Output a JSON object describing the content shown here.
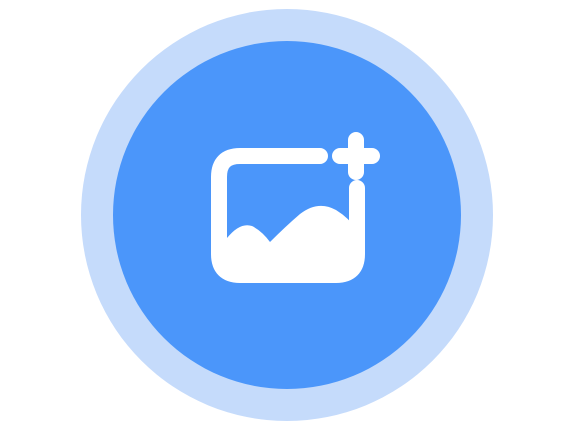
{
  "colors": {
    "ring": "#c5dbfb",
    "circle": "#4b96fa",
    "glyph": "#ffffff"
  },
  "icon": {
    "name": "add-image-icon",
    "description_name": "image-plus"
  }
}
